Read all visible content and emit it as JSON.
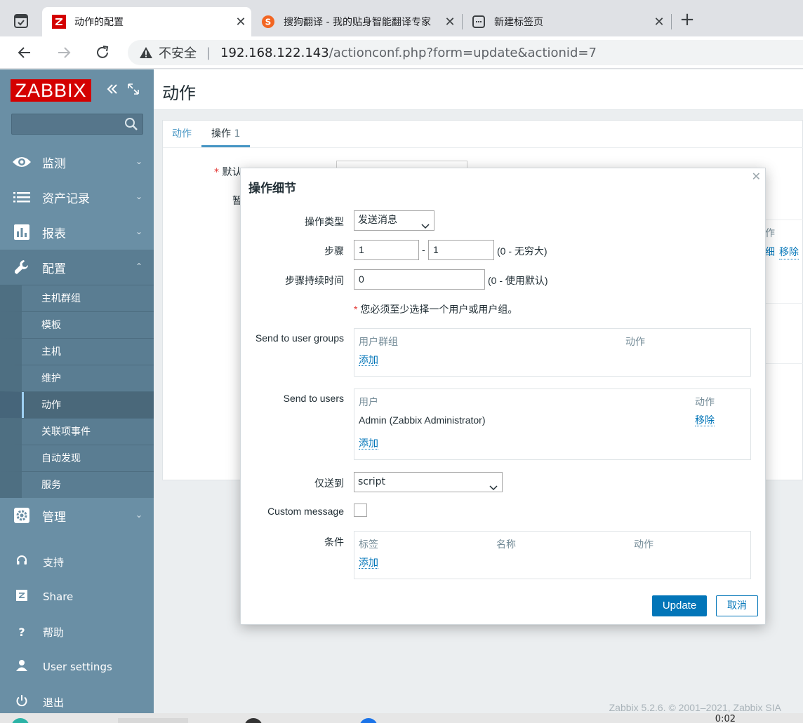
{
  "browser": {
    "tabs": [
      {
        "title": "动作的配置",
        "active": true,
        "icon": "zabbix-favicon"
      },
      {
        "title": "搜狗翻译 - 我的贴身智能翻译专家",
        "active": false,
        "icon": "sogou-favicon"
      },
      {
        "title": "新建标签页",
        "active": false,
        "icon": "new-tab-favicon"
      }
    ],
    "insecure_label": "不安全",
    "url_host": "192.168.122.143",
    "url_path": "/actionconf.php?form=update&actionid=7"
  },
  "sidebar": {
    "logo": "ZABBIX",
    "menu": [
      {
        "label": "监测",
        "icon": "eye-icon"
      },
      {
        "label": "资产记录",
        "icon": "list-icon"
      },
      {
        "label": "报表",
        "icon": "bar-chart-icon"
      },
      {
        "label": "配置",
        "icon": "wrench-icon"
      },
      {
        "label": "管理",
        "icon": "gear-icon"
      }
    ],
    "config_submenu": [
      "主机群组",
      "模板",
      "主机",
      "维护",
      "动作",
      "关联项事件",
      "自动发现",
      "服务"
    ],
    "bottom": [
      {
        "label": "支持",
        "icon": "headset-icon"
      },
      {
        "label": "Share",
        "icon": "zabbix-share-icon"
      },
      {
        "label": "帮助",
        "icon": "question-icon"
      },
      {
        "label": "User settings",
        "icon": "user-icon"
      },
      {
        "label": "退出",
        "icon": "power-icon"
      }
    ]
  },
  "page": {
    "title": "动作",
    "tabs": [
      {
        "label": "动作"
      },
      {
        "label": "操作",
        "count": "1"
      }
    ],
    "bg_label_1": "默认",
    "bg_label_2": "暂",
    "bg_col_frag": "作",
    "bg_link_1": "细",
    "bg_link_2": "移除",
    "footer": "Zabbix 5.2.6. © 2001–2021, Zabbix SIA"
  },
  "modal": {
    "title": "操作细节",
    "operation_type_label": "操作类型",
    "operation_type_value": "发送消息",
    "steps_label": "步骤",
    "step_from": "1",
    "step_sep": "-",
    "step_to": "1",
    "steps_hint": "(0 - 无穷大)",
    "step_duration_label": "步骤持续时间",
    "step_duration_value": "0",
    "step_duration_hint": "(0 - 使用默认)",
    "required_note": "您必须至少选择一个用户或用户组。",
    "user_groups_label": "Send to user groups",
    "user_groups_col1": "用户群组",
    "user_groups_col2": "动作",
    "add_label": "添加",
    "users_label": "Send to users",
    "users_col1": "用户",
    "users_col2": "动作",
    "users_rows": [
      {
        "name": "Admin (Zabbix Administrator)",
        "action": "移除"
      }
    ],
    "send_only_to_label": "仅送到",
    "send_only_to_value": "script",
    "custom_message_label": "Custom message",
    "custom_message_checked": false,
    "conditions_label": "条件",
    "conditions_col1": "标签",
    "conditions_col2": "名称",
    "conditions_col3": "动作",
    "update_button": "Update",
    "cancel_button": "取消"
  },
  "taskbar": {
    "clock": "0:02"
  },
  "colors": {
    "zabbix_red": "#d40000",
    "sidebar_bg": "#6a8fa5",
    "link_blue": "#0275b8"
  }
}
